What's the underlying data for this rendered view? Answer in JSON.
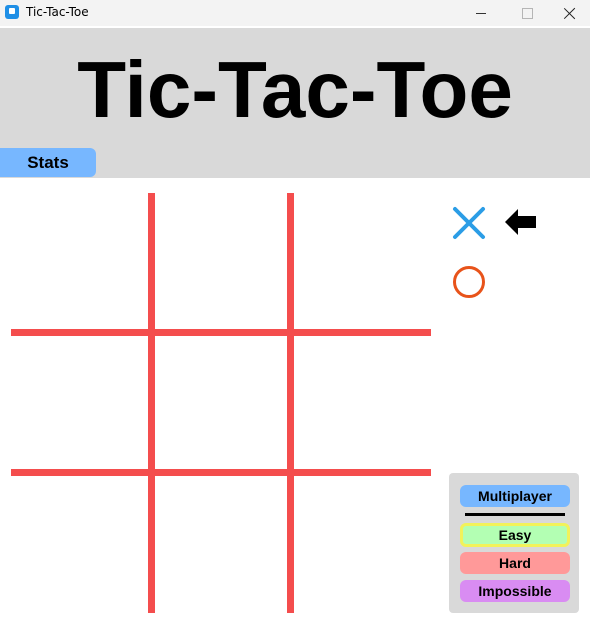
{
  "window": {
    "title": "Tic-Tac-Toe",
    "icon": "app-icon",
    "controls": [
      "minimize-icon",
      "maximize-icon",
      "close-icon"
    ]
  },
  "header": {
    "title": "Tic-Tac-Toe",
    "stats_label": "Stats"
  },
  "board": {
    "cells": [
      "",
      "",
      "",
      "",
      "",
      "",
      "",
      "",
      ""
    ],
    "line_color": "#f44d4d"
  },
  "turn": {
    "x_color": "#2b9de6",
    "o_color": "#e8531a",
    "current": "X",
    "indicator_icon": "left-arrow-icon"
  },
  "modes": {
    "multiplayer": "Multiplayer",
    "easy": "Easy",
    "hard": "Hard",
    "impossible": "Impossible",
    "selected": "Easy"
  },
  "colors": {
    "header_bg": "#d9d9d9",
    "stats_bg": "#77b7ff",
    "multiplayer_bg": "#77b7ff",
    "easy_bg": "#b3ffb3",
    "easy_border": "#f2f25a",
    "hard_bg": "#ff9999",
    "impossible_bg": "#d98cf2"
  }
}
